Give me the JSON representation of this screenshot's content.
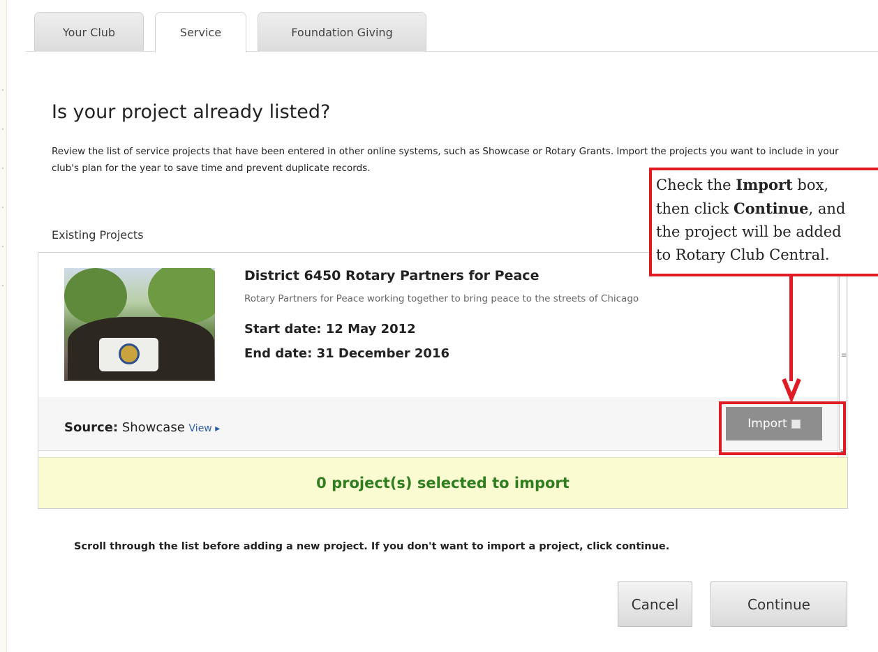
{
  "tabs": [
    {
      "label": "Your Club",
      "active": false
    },
    {
      "label": "Service",
      "active": true
    },
    {
      "label": "Foundation Giving",
      "active": false
    }
  ],
  "page": {
    "title": "Is your project already listed?",
    "intro": "Review the list of service projects that have been entered in other online systems, such as Showcase or Rotary Grants. Import the projects you want to include in your club's plan for the year to save time and prevent duplicate records."
  },
  "existing_projects": {
    "label": "Existing Projects",
    "projects": [
      {
        "title": "District 6450 Rotary Partners for Peace",
        "description": "Rotary Partners for Peace working together to bring peace to the streets of Chicago",
        "start_date": "Start date: 12 May 2012",
        "end_date": "End date: 31 December 2016",
        "source_label": "Source:",
        "source_value": "Showcase",
        "view_link": "View ▸",
        "import_label": "Import",
        "import_checked": false
      }
    ],
    "selected_summary": "0 project(s) selected to import"
  },
  "note": "Scroll through the list before adding a new project. If you don't want to import a project, click continue.",
  "buttons": {
    "cancel": "Cancel",
    "continue": "Continue"
  },
  "callout": {
    "line1_pre": "Check the ",
    "line1_bold": "Import",
    "line1_post": " box,",
    "line2_pre": "then click ",
    "line2_bold": "Continue",
    "line2_post": ", and",
    "line3": "the project will be added",
    "line4": "to Rotary Club Central."
  },
  "colors": {
    "accent_red": "#e01b24",
    "summary_green": "#2e7d1e",
    "summary_bg": "#fbfbd2",
    "link_blue": "#2a5da8"
  }
}
